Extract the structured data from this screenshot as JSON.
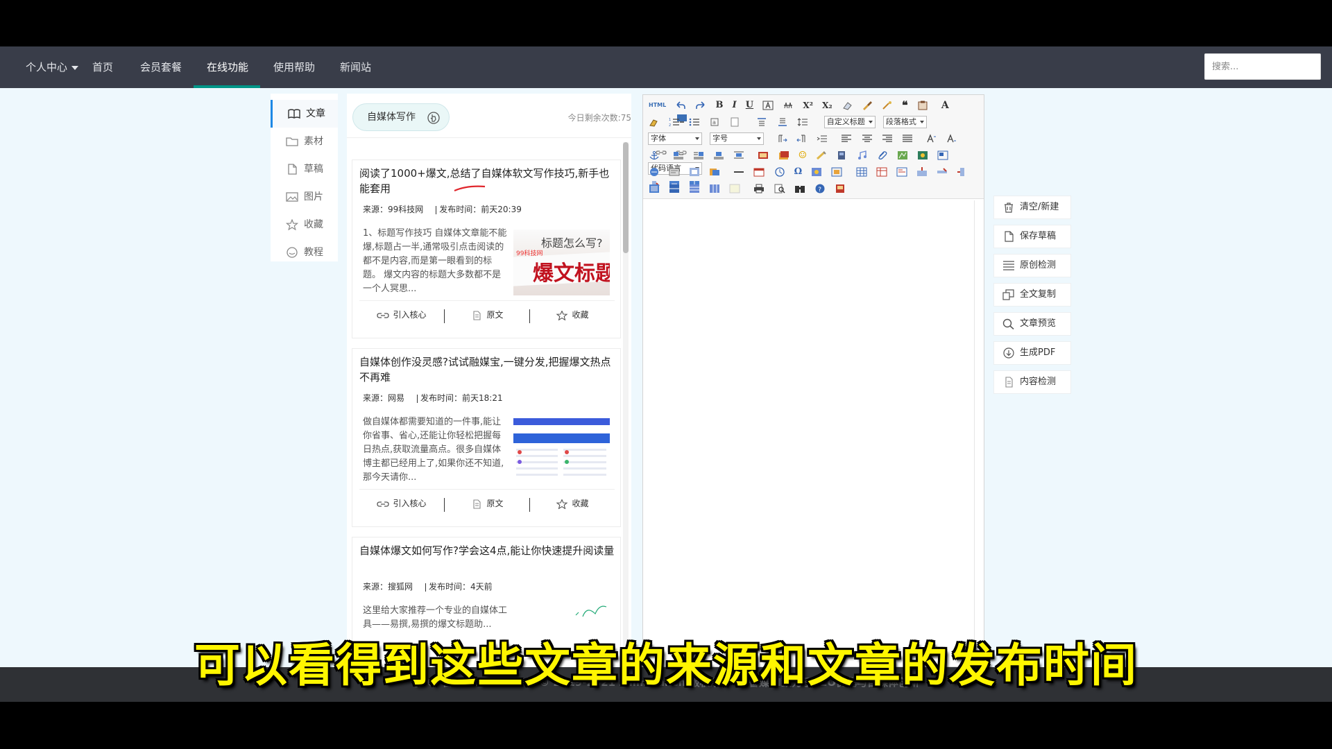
{
  "nav": {
    "items": [
      {
        "label": "个人中心"
      },
      {
        "label": "首页"
      },
      {
        "label": "会员套餐"
      },
      {
        "label": "在线功能"
      },
      {
        "label": "使用帮助"
      },
      {
        "label": "新闻站"
      }
    ],
    "active_index": 3,
    "search_placeholder": "搜索..."
  },
  "left_menu": {
    "items": [
      {
        "label": "文章",
        "icon": "book-icon"
      },
      {
        "label": "素材",
        "icon": "folder-icon"
      },
      {
        "label": "草稿",
        "icon": "file-icon"
      },
      {
        "label": "图片",
        "icon": "image-icon"
      },
      {
        "label": "收藏",
        "icon": "star-icon"
      },
      {
        "label": "教程",
        "icon": "circle-icon"
      }
    ],
    "active_index": 0
  },
  "list": {
    "header_button": "自媒体写作",
    "remaining": "今日剩余次数:75",
    "articles": [
      {
        "title": "阅读了1000+爆文,总结了自媒体软文写作技巧,新手也能套用",
        "source": "来源：99科技网",
        "time": "发布时间：前天20:39",
        "summary": "1、标题写作技巧 自媒体文章能不能爆,标题占一半,通常吸引点击阅读的都不是内容,而是第一眼看到的标题。 爆文内容的标题大多数都不是一个人冥思...",
        "thumb_line1": "标题怎么写?",
        "thumb_tag": "99科技网",
        "thumb_line2": "爆文标题"
      },
      {
        "title": "自媒体创作没灵感?试试融媒宝,一键分发,把握爆文热点不再难",
        "source": "来源：网易",
        "time": "发布时间：前天18:21",
        "summary": "做自媒体都需要知道的一件事,能让你省事、省心,还能让你轻松把握每日热点,获取流量高点。很多自媒体博主都已经用上了,如果你还不知道,那今天请你...",
        "thumb_line1": "",
        "thumb_tag": "",
        "thumb_line2": ""
      },
      {
        "title": "自媒体爆文如何写作?学会这4点,能让你快速提升阅读量",
        "source": "来源：搜狐网",
        "time": "发布时间：4天前",
        "summary": "这里给大家推荐一个专业的自媒体工具——易撰,易撰的爆文标题助...",
        "thumb_line1": "",
        "thumb_tag": "",
        "thumb_line2": ""
      }
    ],
    "actions": {
      "import": "引入核心",
      "original": "原文",
      "favorite": "收藏"
    }
  },
  "editor": {
    "html_label": "HTML",
    "font_family": "字体",
    "font_size": "字号",
    "custom_title": "自定义标题",
    "paragraph_format": "段落格式",
    "code_language": "代码语言",
    "text_color_label": "A"
  },
  "side_actions": [
    {
      "label": "清空/新建",
      "icon": "trash-icon"
    },
    {
      "label": "保存草稿",
      "icon": "file-icon"
    },
    {
      "label": "原创检测",
      "icon": "lines-icon"
    },
    {
      "label": "全文复制",
      "icon": "copy-icon"
    },
    {
      "label": "文章预览",
      "icon": "search-icon"
    },
    {
      "label": "生成PDF",
      "icon": "download-icon"
    },
    {
      "label": "内容检测",
      "icon": "doc-icon"
    }
  ],
  "footer": {
    "text": "鄂ICP备2021006635号 © 2019-2021 zhimeiai.cn 版权所有 ｜ 智媒AI致力于SEO优化与自媒体创新"
  },
  "subtitle": "可以看得到这些文章的来源和文章的发布时间",
  "colors": {
    "nav_bg": "#393d49",
    "nav_active_underline": "#009688",
    "content_bg": "#eef8fd",
    "subtitle": "#fff600"
  }
}
